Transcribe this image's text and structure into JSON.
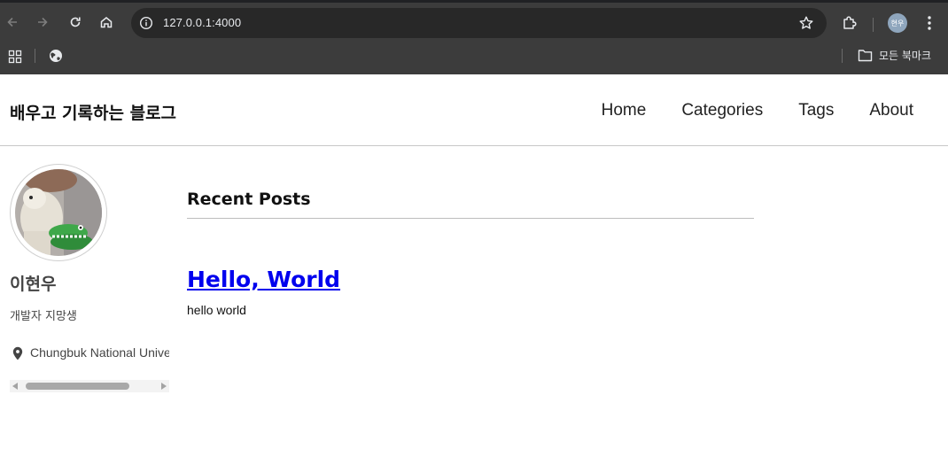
{
  "browser": {
    "url": "127.0.0.1:4000",
    "profile_initials": "현우",
    "bookmarks_folder_label": "모든 북마크",
    "icons": [
      "back-icon",
      "forward-icon",
      "reload-icon",
      "home-icon",
      "site-info-icon",
      "bookmark-star-icon",
      "extensions-icon",
      "kebab-menu-icon",
      "apps-grid-icon",
      "globe-icon",
      "folder-icon"
    ]
  },
  "site": {
    "title": "배우고 기록하는 블로그",
    "nav": [
      {
        "label": "Home"
      },
      {
        "label": "Categories"
      },
      {
        "label": "Tags"
      },
      {
        "label": "About"
      }
    ]
  },
  "sidebar": {
    "author_name": "이현우",
    "author_bio": "개발자 지망생",
    "location": "Chungbuk National University"
  },
  "main": {
    "section_heading": "Recent Posts",
    "posts": [
      {
        "title": "Hello, World",
        "excerpt": "hello world"
      }
    ]
  },
  "colors": {
    "chrome_bg": "#3c3c3c",
    "omnibox_bg": "#282828",
    "link": "#0000ee",
    "text": "#111111"
  }
}
